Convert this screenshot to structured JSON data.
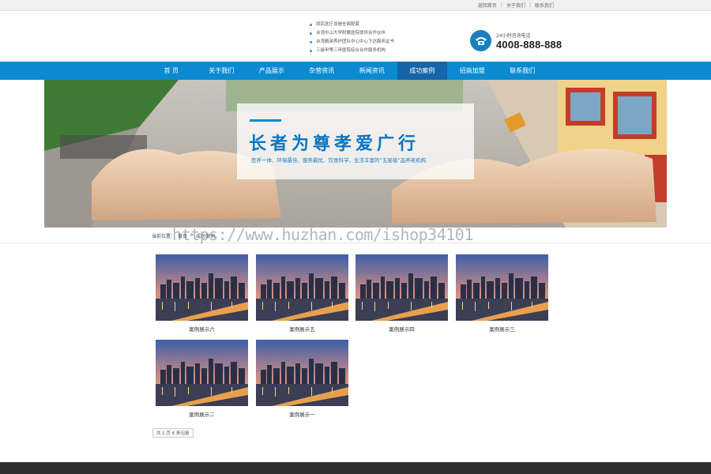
{
  "topbar": {
    "links": [
      "返回首页",
      "关于我们",
      "联系我们"
    ]
  },
  "header": {
    "features": [
      "原民医疗设施全面配套",
      "台湾中山大学附属医院提供合作伙伴",
      "台湾精英养护团队中心中心下达服务证书",
      "三级甲等三甲医院综合合作服务机构"
    ],
    "phone_label": "24小时咨询电话",
    "phone_number": "4008-888-888"
  },
  "nav": {
    "items": [
      "首 页",
      "关于我们",
      "产品展示",
      "杂营资讯",
      "新闻资讯",
      "成功案例",
      "招商加盟",
      "联系我们"
    ],
    "active": 5
  },
  "banner": {
    "title": "长者为尊孝爱广行",
    "subtitle": "医养一体、环境最佳、服务最优、饮食科学、生活丰富的“五星级”品养老机构"
  },
  "breadcrumb": {
    "label": "当前位置：",
    "items": [
      "首页",
      ">",
      "成功案例"
    ]
  },
  "watermark": "https://www.huzhan.com/ishop34101",
  "cases": [
    {
      "caption": "案例展示六"
    },
    {
      "caption": "案例展示五"
    },
    {
      "caption": "案例展示四"
    },
    {
      "caption": "案例展示三"
    },
    {
      "caption": "案例展示二"
    },
    {
      "caption": "案例展示一"
    }
  ],
  "pager": {
    "text": "共 1 页 6 条记录"
  },
  "colors": {
    "nav": "#0b8ad2",
    "nav_active": "#1565a8",
    "footer": "#2e2e2e"
  }
}
